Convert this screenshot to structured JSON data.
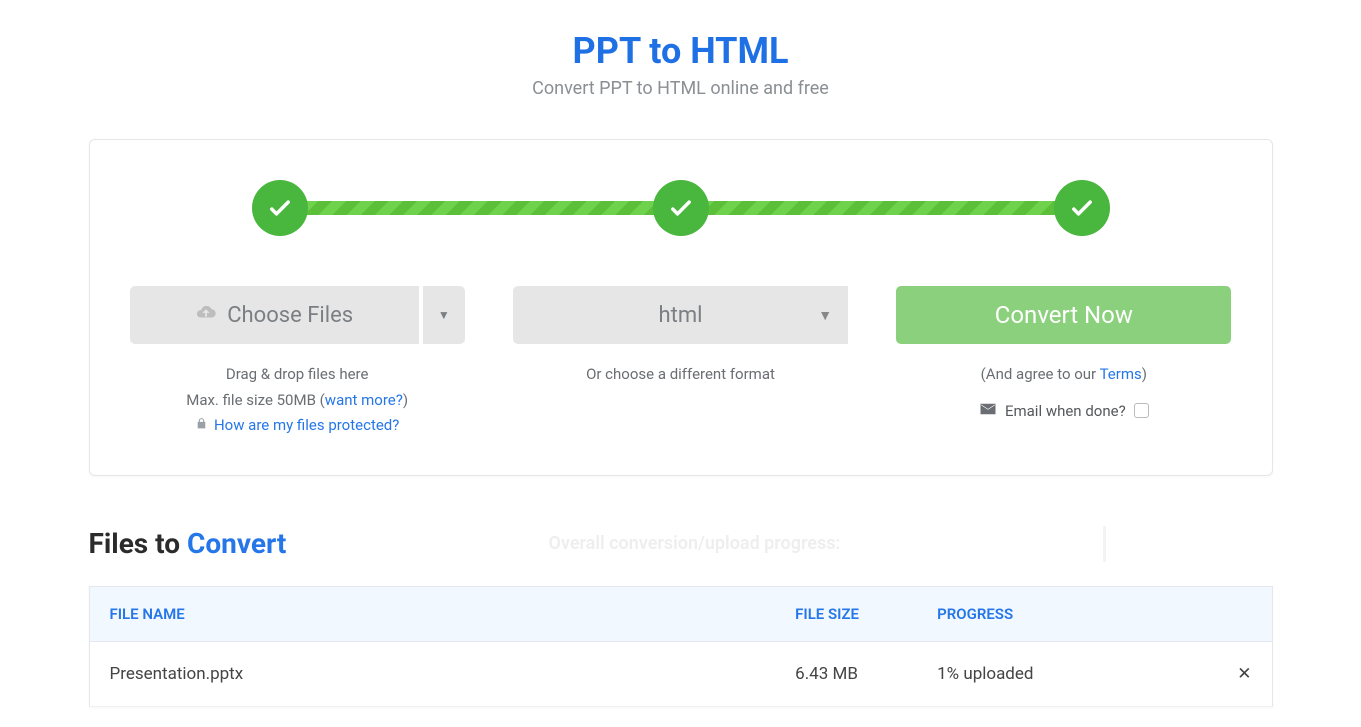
{
  "header": {
    "title": "PPT to HTML",
    "subtitle": "Convert PPT to HTML online and free"
  },
  "col1": {
    "choose_label": "Choose Files",
    "helper_line1": "Drag & drop files here",
    "helper_line2_pre": "Max. file size 50MB (",
    "helper_line2_link": "want more?",
    "helper_line2_post": ")",
    "protect_link": "How are my files protected?"
  },
  "col2": {
    "format": "html",
    "helper": "Or choose a different format"
  },
  "col3": {
    "convert_label": "Convert Now",
    "agree_pre": "(And agree to our ",
    "agree_link": "Terms",
    "agree_post": ")",
    "email_label": "Email when done?"
  },
  "section2": {
    "title_black": "Files to ",
    "title_blue": "Convert",
    "overall_label": "Overall conversion/upload progress:"
  },
  "table": {
    "headers": {
      "name": "FILE NAME",
      "size": "FILE SIZE",
      "progress": "PROGRESS"
    },
    "rows": [
      {
        "name": "Presentation.pptx",
        "size": "6.43 MB",
        "progress": "1% uploaded"
      }
    ]
  }
}
